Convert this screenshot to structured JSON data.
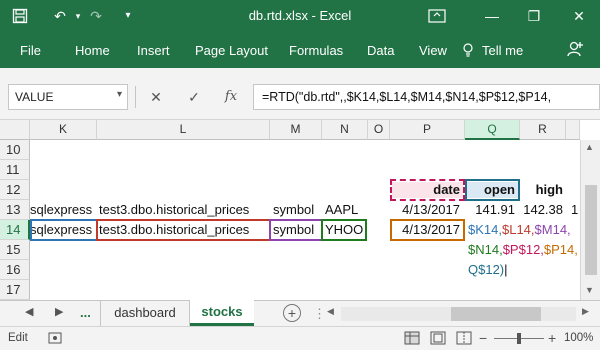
{
  "window": {
    "title": "db.rtd.xlsx - Excel"
  },
  "ribbon_tabs": [
    "File",
    "Home",
    "Insert",
    "Page Layout",
    "Formulas",
    "Data",
    "View"
  ],
  "tell_me": "Tell me",
  "name_box": "VALUE",
  "formula_bar": {
    "fx": "fx",
    "content": "=RTD(\"db.rtd\",,$K14,$L14,$M14,$N14,$P$12,$P14,"
  },
  "columns": [
    "K",
    "L",
    "M",
    "N",
    "O",
    "P",
    "Q",
    "R"
  ],
  "rows": [
    "10",
    "11",
    "12",
    "13",
    "14",
    "15",
    "16",
    "17"
  ],
  "cells": {
    "p12": "date",
    "q12": "open",
    "r12": "high",
    "k13": "sqlexpress",
    "l13": "test3.dbo.historical_prices",
    "m13": "symbol",
    "n13": "AAPL",
    "p13": "4/13/2017",
    "q13": "141.91",
    "r13": "142.38",
    "k14": "sqlexpress",
    "l14": "test3.dbo.historical_prices",
    "m14": "symbol",
    "n14": "YHOO",
    "p14": "4/13/2017"
  },
  "edit_formula": {
    "l1_a": "$K14,",
    "l1_b": "$L14,",
    "l1_c": "$M14,",
    "l2_a": "$N14,",
    "l2_b": "$P$12,",
    "l2_c": "$P14,",
    "l3_a": "Q$12)"
  },
  "sheet_tabs": {
    "ellipsis": "...",
    "tab1": "dashboard",
    "tab2": "stocks",
    "add": "+"
  },
  "status": {
    "mode": "Edit",
    "zoom": "100%"
  },
  "colors": {
    "brand": "#217346"
  }
}
